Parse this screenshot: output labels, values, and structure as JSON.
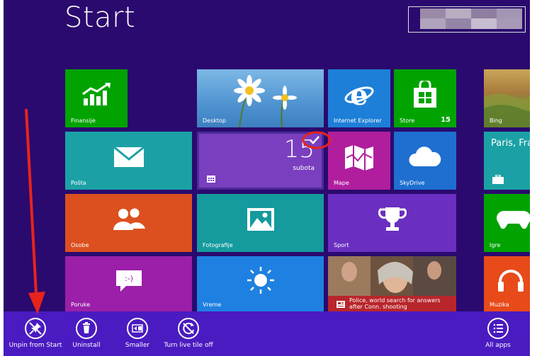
{
  "header": {
    "title": "Start"
  },
  "tiles": {
    "finansije": {
      "label": "Finansije"
    },
    "desktop": {
      "label": "Desktop"
    },
    "ie": {
      "label": "Internet Explorer"
    },
    "store": {
      "label": "Store",
      "badge": "15"
    },
    "bing": {
      "label": "Bing"
    },
    "posta": {
      "label": "Pošta"
    },
    "calendar": {
      "day": "15",
      "weekday": "subota"
    },
    "mape": {
      "label": "Mape"
    },
    "skydrive": {
      "label": "SkyDrive"
    },
    "weather": {
      "city": "Paris, Fra"
    },
    "osobe": {
      "label": "Osobe"
    },
    "fotografije": {
      "label": "Fotografije"
    },
    "sport": {
      "label": "Sport"
    },
    "igre": {
      "label": "Igre"
    },
    "poruke": {
      "label": "Poruke"
    },
    "vreme": {
      "label": "Vreme"
    },
    "news": {
      "headline": "Police, world search for answers after Conn. shooting"
    },
    "muzika": {
      "label": "Muzika"
    }
  },
  "appbar": {
    "unpin": "Unpin from Start",
    "uninstall": "Uninstall",
    "smaller": "Smaller",
    "live_tile_off": "Turn live tile off",
    "all_apps": "All apps"
  },
  "colors": {
    "background": "#2a0a6e",
    "appbar": "#4a1bc0",
    "green": "#00a300",
    "teal": "#1ba1a5",
    "blue": "#1e7fd8",
    "purple": "#7a1fa8",
    "orange": "#dc5020",
    "annotation_red": "#e8231c"
  }
}
